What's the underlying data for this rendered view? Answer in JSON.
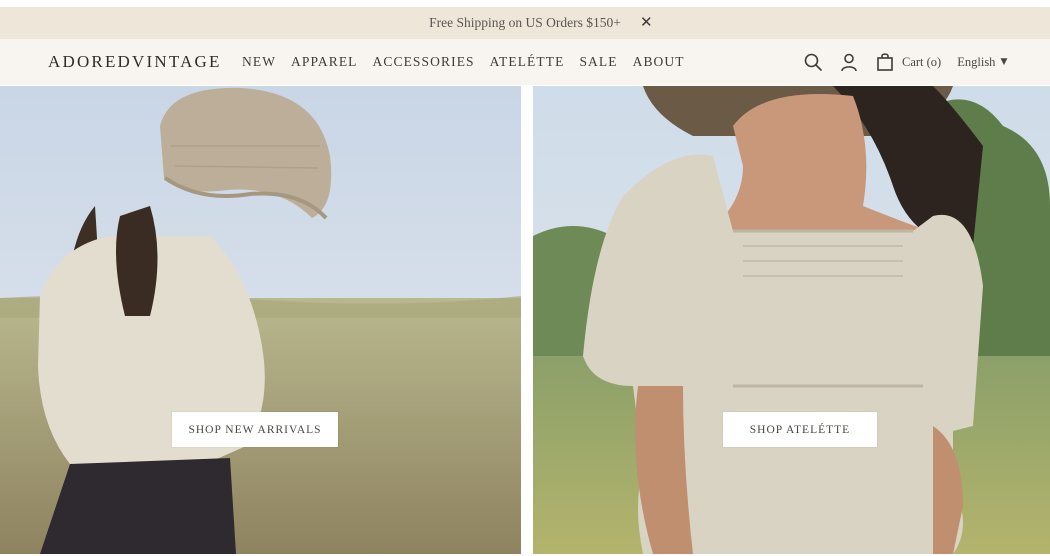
{
  "announcement": {
    "text": "Free Shipping on US Orders $150+",
    "close_glyph": "✕"
  },
  "header": {
    "logo": "ADOREDVINTAGE",
    "nav": [
      "NEW",
      "APPAREL",
      "ACCESSORIES",
      "ATELÉTTE",
      "SALE",
      "ABOUT"
    ],
    "icons": [
      "search-icon",
      "account-icon",
      "cart-bag-icon"
    ],
    "cart_label": "Cart (o)",
    "language": "English"
  },
  "hero": {
    "left_cta": "SHOP NEW ARRIVALS",
    "right_cta": "SHOP ATELÉTTE"
  },
  "colors": {
    "announcement_bg": "#efe6da",
    "header_bg": "#f8f5f0",
    "text": "#3b3a36",
    "cta_bg": "#ffffff"
  }
}
